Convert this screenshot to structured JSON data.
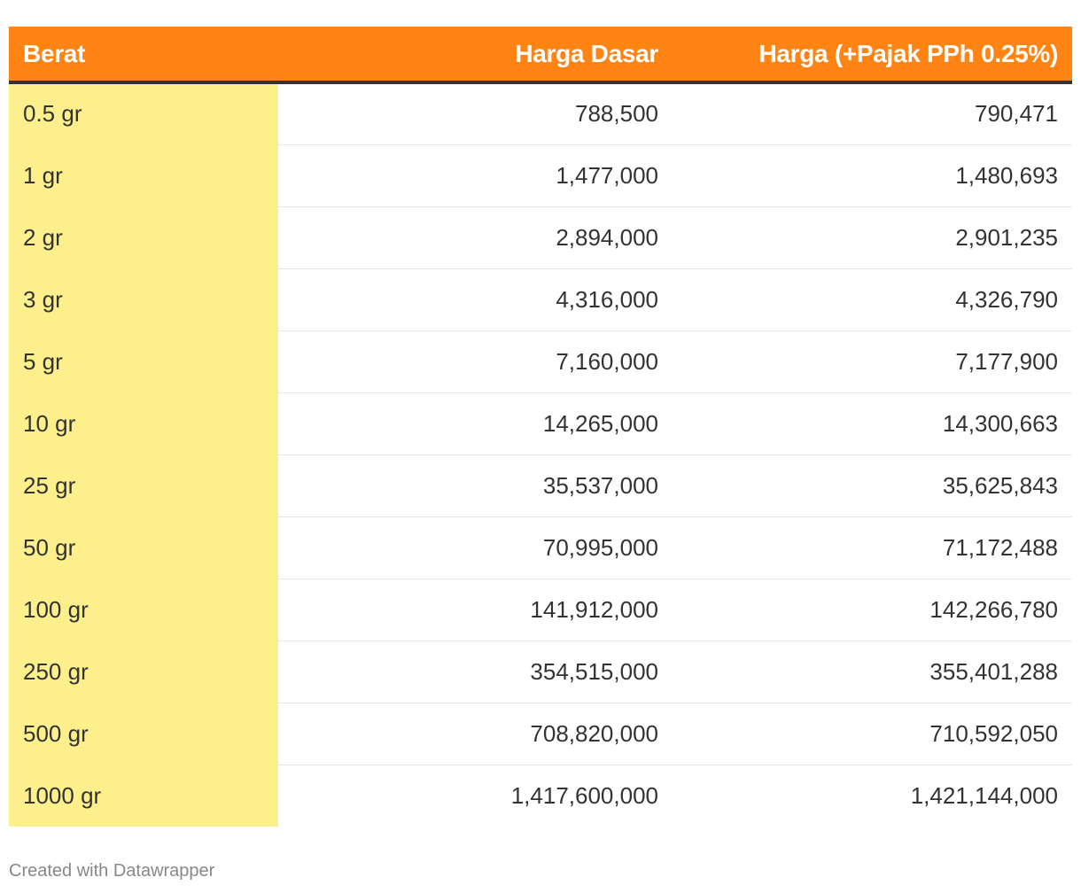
{
  "chart_data": {
    "type": "table",
    "columns": [
      "Berat",
      "Harga Dasar",
      "Harga (+Pajak PPh 0.25%)"
    ],
    "rows": [
      [
        "0.5 gr",
        "788,500",
        "790,471"
      ],
      [
        "1 gr",
        "1,477,000",
        "1,480,693"
      ],
      [
        "2 gr",
        "2,894,000",
        "2,901,235"
      ],
      [
        "3 gr",
        "4,316,000",
        "4,326,790"
      ],
      [
        "5 gr",
        "7,160,000",
        "7,177,900"
      ],
      [
        "10 gr",
        "14,265,000",
        "14,300,663"
      ],
      [
        "25 gr",
        "35,537,000",
        "35,625,843"
      ],
      [
        "50 gr",
        "70,995,000",
        "71,172,488"
      ],
      [
        "100 gr",
        "141,912,000",
        "142,266,780"
      ],
      [
        "250 gr",
        "354,515,000",
        "355,401,288"
      ],
      [
        "500 gr",
        "708,820,000",
        "710,592,050"
      ],
      [
        "1000 gr",
        "1,417,600,000",
        "1,421,144,000"
      ]
    ],
    "colors": {
      "header_bg": "#ff8413",
      "header_text": "#ffffff",
      "highlight_column": "#fdf08c",
      "text": "#333333"
    }
  },
  "footer": {
    "credit": "Created with Datawrapper"
  }
}
